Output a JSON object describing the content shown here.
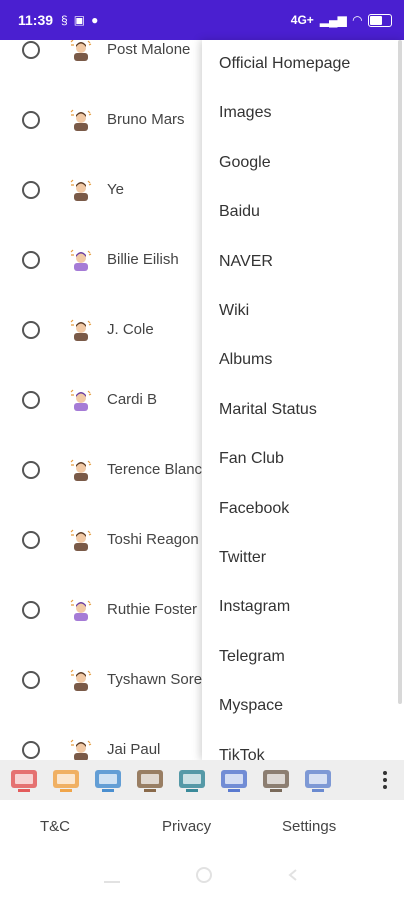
{
  "status_bar": {
    "time": "11:39",
    "network": "4G+",
    "battery_level": 0.55
  },
  "list": {
    "rows": [
      {
        "name": "Post Malone",
        "avatar": "male-singer-icon"
      },
      {
        "name": "Bruno Mars",
        "avatar": "male-singer-icon"
      },
      {
        "name": "Ye",
        "avatar": "male-singer-icon"
      },
      {
        "name": "Billie Eilish",
        "avatar": "female-singer-icon"
      },
      {
        "name": "J. Cole",
        "avatar": "male-singer-icon"
      },
      {
        "name": "Cardi B",
        "avatar": "female-singer-icon"
      },
      {
        "name": "Terence Blanchard",
        "avatar": "male-singer-icon"
      },
      {
        "name": "Toshi Reagon",
        "avatar": "male-singer-icon"
      },
      {
        "name": "Ruthie Foster",
        "avatar": "female-singer-icon"
      },
      {
        "name": "Tyshawn Sorey",
        "avatar": "male-singer-icon"
      },
      {
        "name": "Jai Paul",
        "avatar": "male-singer-icon"
      }
    ]
  },
  "menu": {
    "items": [
      "Official Homepage",
      "Images",
      "Google",
      "Baidu",
      "NAVER",
      "Wiki",
      "Albums",
      "Marital Status",
      "Fan Club",
      "Facebook",
      "Twitter",
      "Instagram",
      "Telegram",
      "Myspace",
      "TikTok"
    ]
  },
  "toolbar": {
    "icons": [
      "video-screen-icon",
      "award-badge-icon",
      "audience-icon",
      "explorer-icon",
      "music-studio-icon",
      "camera-icon",
      "building-icon",
      "monitor-icon"
    ]
  },
  "footer": {
    "tc": "T&C",
    "privacy": "Privacy",
    "settings": "Settings"
  },
  "colors": {
    "status_bar": "#4a1fd0",
    "toolbar_bg": "#eeeeee"
  }
}
